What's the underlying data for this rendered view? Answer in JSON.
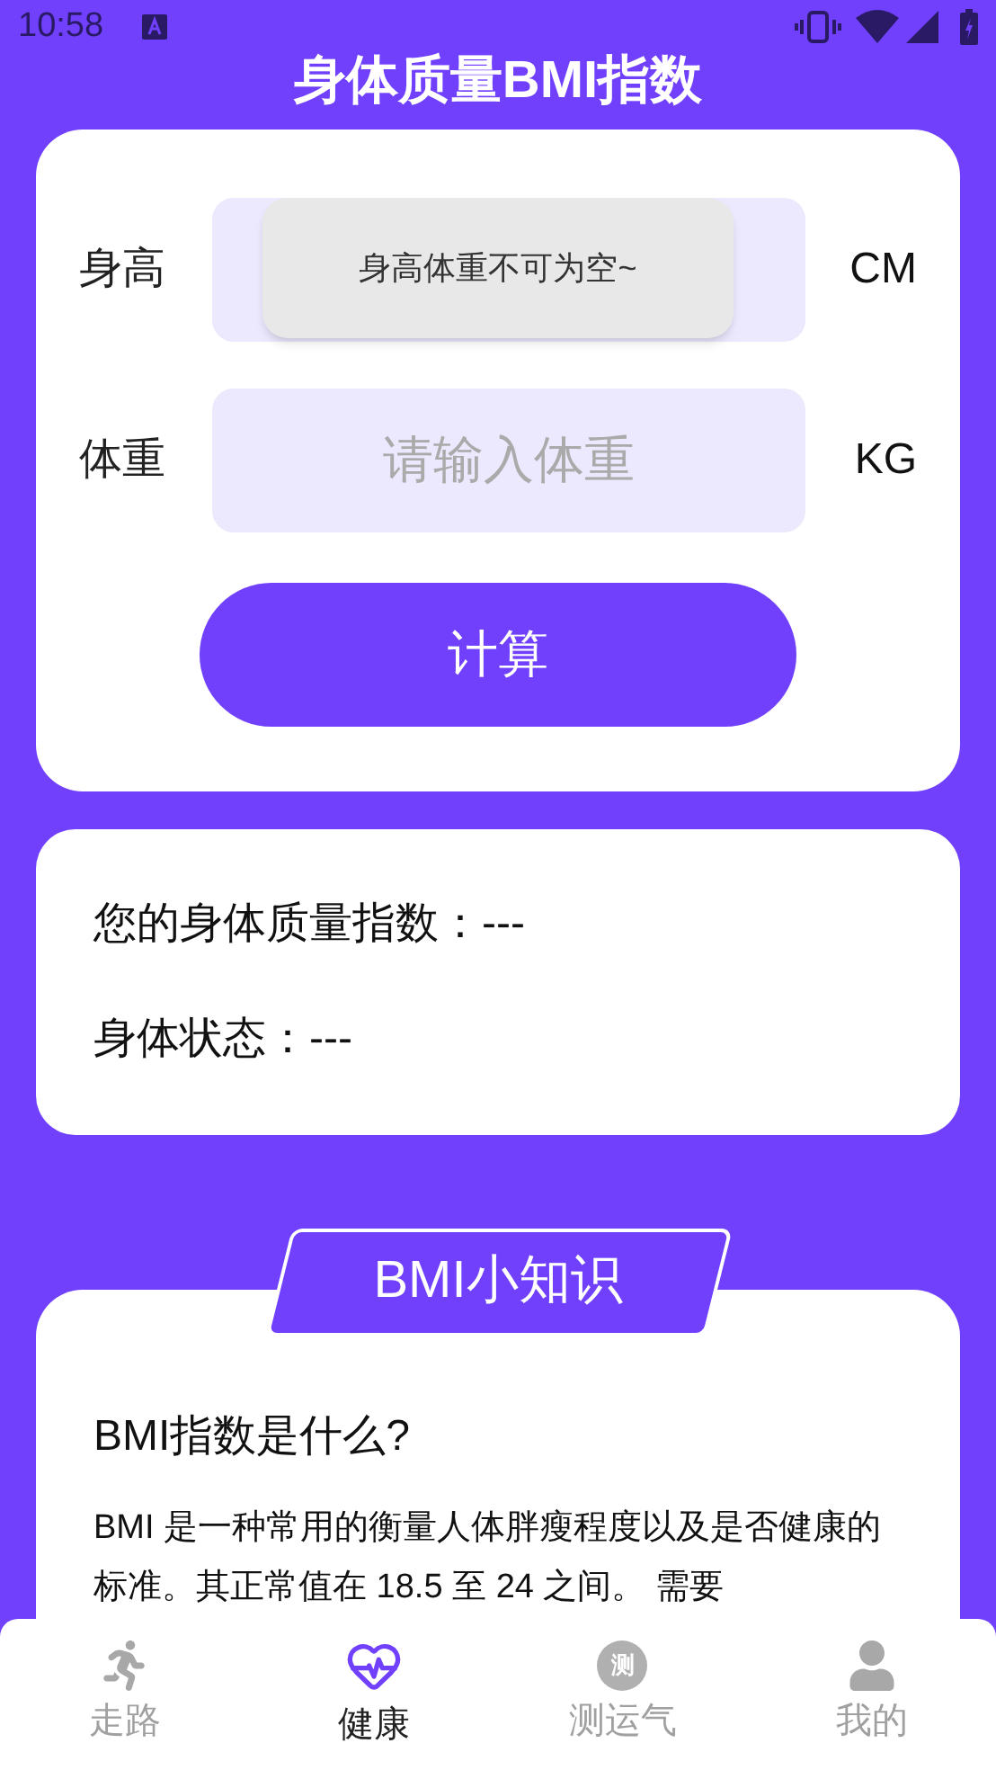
{
  "status_bar": {
    "time": "10:58"
  },
  "title": "身体质量BMI指数",
  "form": {
    "fields": [
      {
        "label": "身高",
        "unit": "CM"
      },
      {
        "label": "体重",
        "placeholder": "请输入体重",
        "unit": "KG"
      }
    ],
    "button": "计算",
    "toast": "身高体重不可为空~"
  },
  "result": {
    "lines": [
      "您的身体质量指数：---",
      "身体状态：---"
    ]
  },
  "knowledge": {
    "badge": "BMI小知识",
    "heading": "BMI指数是什么?",
    "paragraph": "BMI 是一种常用的衡量人体胖瘦程度以及是否健康的标准。其正常值在 18.5 至 24 之间。 需要"
  },
  "nav": [
    {
      "kind": "run",
      "label": "走路",
      "selected": false
    },
    {
      "kind": "heart",
      "label": "健康",
      "selected": true
    },
    {
      "kind": "glyph",
      "glyph": "测",
      "label": "测运气",
      "selected": false
    },
    {
      "kind": "user",
      "label": "我的",
      "selected": false
    }
  ]
}
